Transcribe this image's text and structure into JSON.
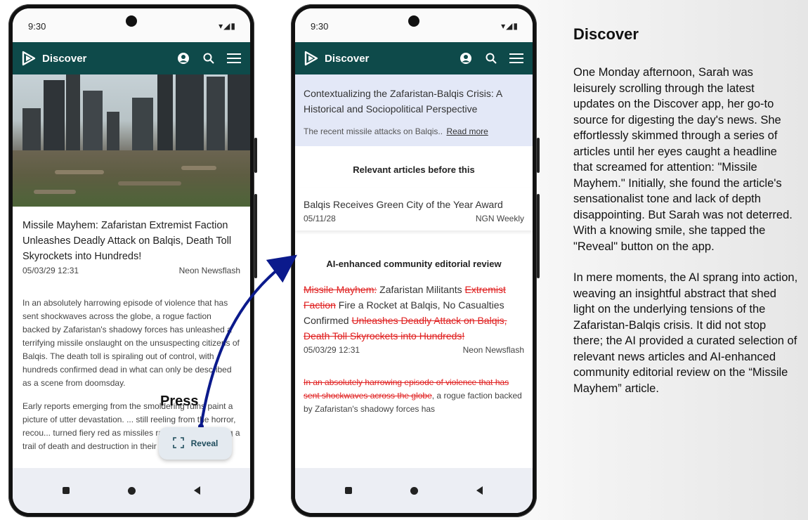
{
  "phone1": {
    "status": {
      "time": "9:30"
    },
    "appbar": {
      "title": "Discover"
    },
    "article": {
      "title": "Missile Mayhem: Zafaristan Extremist Faction Unleashes Deadly Attack on Balqis, Death Toll Skyrockets into Hundreds!",
      "date": "05/03/29 12:31",
      "source": "Neon Newsflash",
      "paragraphs": [
        "In an absolutely harrowing episode of violence that has sent shockwaves across the globe, a rogue faction backed by Zafaristan's shadowy forces has unleashed a terrifying missile onslaught on the unsuspecting citizens of Balqis. The death toll is spiraling out of control, with hundreds confirmed dead in what can only be described as a scene from doomsday.",
        "Early reports emerging from the smoldering ruins paint a picture of utter devastation. ... still reeling from the horror, recou... turned fiery red as missiles rained down, leaving a trail of death and destruction in their wake."
      ]
    },
    "reveal_button": {
      "label": "Reveal"
    },
    "annotation": {
      "press": "Press"
    }
  },
  "phone2": {
    "status": {
      "time": "9:30"
    },
    "appbar": {
      "title": "Discover"
    },
    "summary": {
      "title": "Contextualizing the Zafaristan-Balqis Crisis: A Historical and Sociopolitical Perspective",
      "snippet": "The recent missile attacks on Balqis..",
      "read_more": "Read more"
    },
    "relevant": {
      "heading": "Relevant articles before this",
      "items": [
        {
          "title": "Balqis Receives Green City of the Year Award",
          "date": "05/11/28",
          "source": "NGN Weekly"
        }
      ]
    },
    "editorial": {
      "heading": "AI-enhanced community editorial review",
      "title_strike_1": "Missile Mayhem:",
      "title_keep_1": " Zafaristan Militants ",
      "title_strike_2": "Extremist Faction",
      "title_keep_2": " Fire a Rocket at Balqis, No Casualties Confirmed ",
      "title_strike_3": "Unleashes Deadly Attack on Balqis, Death Toll Skyrockets into Hundreds!",
      "date": "05/03/29 12:31",
      "source": "Neon Newsflash",
      "body_strike": "In an absolutely harrowing episode of violence that has sent shockwaves across the globe",
      "body_keep": ", a rogue faction backed by Zafaristan's shadowy forces has"
    }
  },
  "description": {
    "heading": "Discover",
    "paragraphs": [
      "One Monday afternoon, Sarah was leisurely scrolling through the latest updates on the Discover app, her go-to source for digesting the day's news. She effortlessly skimmed through a series of articles until her eyes caught a headline that screamed for attention: \"Missile Mayhem.\" Initially, she found the article's sensationalist tone and lack of depth disappointing. But Sarah was not deterred. With a knowing smile, she tapped the \"Reveal\" button on the app.",
      "In mere moments, the AI sprang into action, weaving an insightful abstract that shed light on the underlying tensions of the Zafaristan-Balqis crisis. It did not stop there; the AI provided a curated selection of relevant news articles and AI-enhanced community editorial review on the “Missile Mayhem” article."
    ]
  },
  "colors": {
    "appbar": "#0e4a4a",
    "strike": "#e02020",
    "summary_bg": "#e3e8f7",
    "arrow": "#0b1a8c"
  }
}
